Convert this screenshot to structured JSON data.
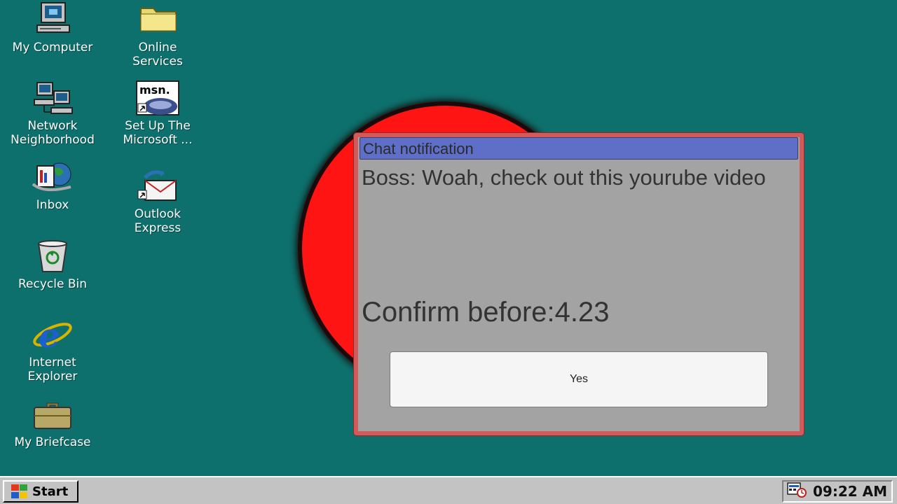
{
  "desktop": {
    "icons": [
      {
        "label": "My Computer"
      },
      {
        "label": "Online\nServices"
      },
      {
        "label": "Network\nNeighborhood"
      },
      {
        "label": "Set Up The\nMicrosoft ..."
      },
      {
        "label": "Inbox"
      },
      {
        "label": "Outlook\nExpress"
      },
      {
        "label": "Recycle Bin"
      },
      {
        "label": "Internet\nExplorer"
      },
      {
        "label": "My Briefcase"
      }
    ],
    "msn_text": "msn."
  },
  "dialog": {
    "title": "Chat notification",
    "message": "Boss: Woah, check out this yourube video",
    "confirm_text": "Confirm before:4.23",
    "yes_label": "Yes",
    "colors": {
      "border": "#d25a5a",
      "titlebar": "#5f6fc8",
      "body": "#a3a3a3"
    }
  },
  "taskbar": {
    "start_label": "Start",
    "clock": "09:22 AM"
  },
  "icon_names": [
    "computer-icon",
    "folder-icon",
    "network-icon",
    "msn-icon",
    "inbox-icon",
    "outlook-icon",
    "recycle-bin-icon",
    "internet-explorer-icon",
    "briefcase-icon",
    "windows-logo-icon",
    "tray-scheduler-icon"
  ]
}
